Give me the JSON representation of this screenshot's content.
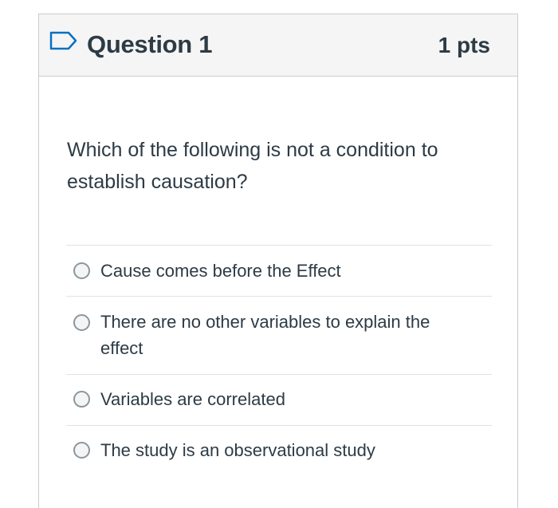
{
  "question": {
    "icon": "flag-outline-icon",
    "title": "Question 1",
    "points": "1 pts",
    "text": "Which of the following is not a condition to establish causation?",
    "accent_color": "#2d3b45",
    "flag_color": "#0a70c0"
  },
  "answers": [
    {
      "label": "Cause comes before the Effect"
    },
    {
      "label": "There are no other variables to explain the effect"
    },
    {
      "label": "Variables are correlated"
    },
    {
      "label": "The study is an observational study"
    }
  ]
}
